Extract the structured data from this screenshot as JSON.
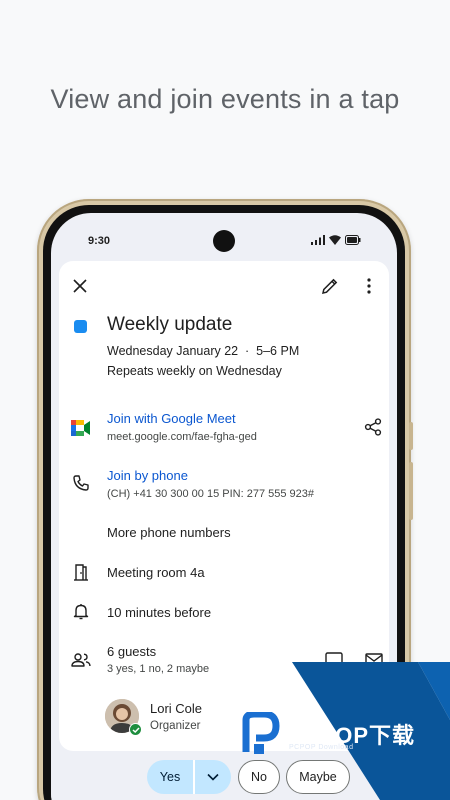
{
  "headline": "View and join events in a tap",
  "status_bar": {
    "time": "9:30"
  },
  "event": {
    "color": "#1a8cf0",
    "title": "Weekly update",
    "date_line": "Wednesday January 22  ·  5–6 PM",
    "repeat_line": "Repeats weekly on Wednesday",
    "meet": {
      "label": "Join with Google Meet",
      "url": "meet.google.com/fae-fgha-ged"
    },
    "phone": {
      "label": "Join by phone",
      "details": "(CH) +41 30 300 00 15 PIN: 277 555 923#"
    },
    "more_numbers": "More phone numbers",
    "room": "Meeting room 4a",
    "reminder": "10 minutes before",
    "guests": {
      "title": "6 guests",
      "summary": "3 yes, 1 no, 2 maybe"
    },
    "organizer": {
      "name": "Lori Cole",
      "role": "Organizer"
    }
  },
  "rsvp": {
    "yes": "Yes",
    "no": "No",
    "maybe": "Maybe"
  },
  "watermark": {
    "brand": "PCPOP下载",
    "sub": "PCPOP Download"
  },
  "icons": {
    "close": "close-icon",
    "edit": "pencil-icon",
    "more": "more-vert-icon",
    "meet": "google-meet-icon",
    "share": "share-icon",
    "phone": "phone-icon",
    "room": "door-icon",
    "reminder": "bell-icon",
    "guests": "people-icon"
  }
}
